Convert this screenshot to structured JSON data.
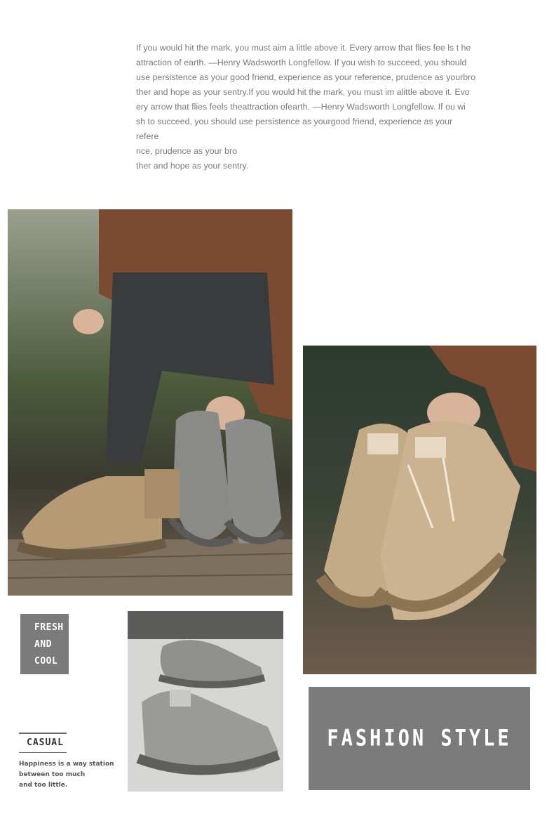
{
  "quote": {
    "lines": [
      "If you would hit the mark, you must aim a little above it. Every arrow that flies fee ls t he",
      " attraction of earth. —Henry Wadsworth Longfellow. If you wish to succeed, you should",
      "use persistence as your good friend, experience as your reference, prudence as yourbro",
      "ther and hope as your sentry.If you would hit the mark, you must im alittle above it. Evo",
      "ery arrow that flies feels theattraction ofearth. —Henry Wadsworth Longfellow. If  ou wi",
      "sh to succeed, you should use persistence as yourgood friend, experience as your refere",
      "nce, prudence as your bro",
      "ther and hope as your sentry."
    ]
  },
  "fresh_box": {
    "line1": "FRESH",
    "line2": "AND",
    "line3": "COOL"
  },
  "casual": {
    "title": "CASUAL",
    "sub1": "Happiness is a way station",
    "sub2": "between too much",
    "sub3": "and too little."
  },
  "fashion_box": {
    "text": "FASHION STYLE"
  },
  "photos": {
    "photo1": "person-holding-grey-and-tan-sneakers",
    "photo2": "hand-holding-beige-sneakers",
    "photo3": "grey-sneakers-pair"
  },
  "colors": {
    "box_grey": "#7b7b7b",
    "text_grey": "#7a7a7a",
    "shoe_tan": "#b59a74",
    "shoe_grey": "#8a8a88"
  }
}
